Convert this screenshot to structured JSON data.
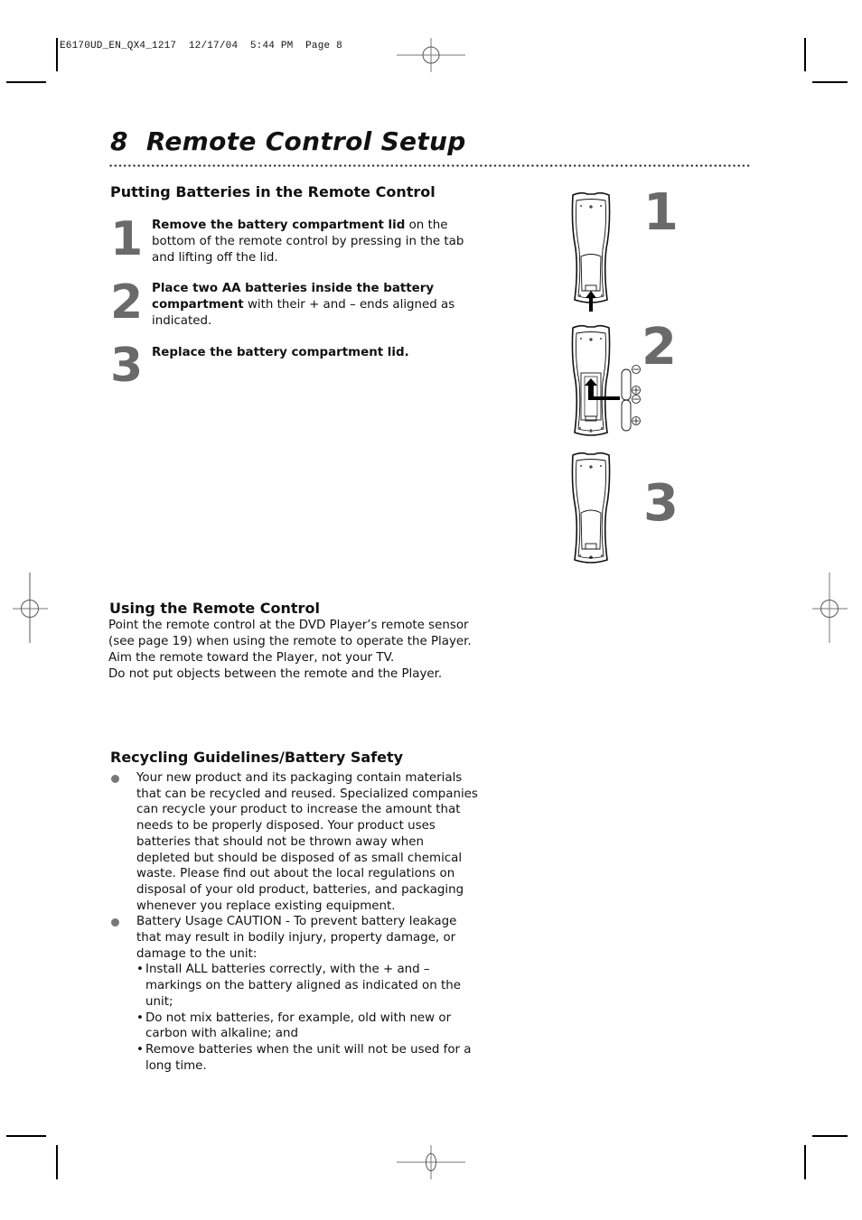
{
  "print_slug": {
    "file": "E6170UD_EN_QX4_1217",
    "date": "12/17/04",
    "time": "5:44 PM",
    "page_label": "Page 8"
  },
  "page": {
    "number": "8",
    "title": "Remote Control Setup"
  },
  "batteries_section": {
    "heading": "Putting Batteries in the Remote Control",
    "steps": [
      {
        "number": "1",
        "bold": "Remove the battery compartment lid",
        "text": " on the bottom of the remote control by pressing in the tab and lifting off the lid."
      },
      {
        "number": "2",
        "bold": "Place two AA batteries inside the battery compartment",
        "text": " with their + and – ends aligned as indicated."
      },
      {
        "number": "3",
        "bold": "Replace the battery compartment lid.",
        "text": ""
      }
    ]
  },
  "illustrations": [
    {
      "number": "1",
      "icon": "remote-lid-removal-illustration"
    },
    {
      "number": "2",
      "icon": "remote-battery-insert-illustration",
      "battery_marks": [
        "⊖",
        "⊕",
        "⊖",
        "⊕"
      ]
    },
    {
      "number": "3",
      "icon": "remote-lid-replaced-illustration"
    }
  ],
  "using_section": {
    "heading": "Using the Remote Control",
    "lines": [
      "Point the remote control at the DVD Player’s remote sensor",
      "(see page 19) when using the remote to operate the Player.",
      "Aim the remote toward the Player, not your TV.",
      "Do not put objects between the remote and the Player."
    ]
  },
  "recycling_section": {
    "heading": "Recycling Guidelines/Battery Safety",
    "bullets": [
      {
        "text": "Your new product and its packaging contain materials that can be recycled and reused. Specialized companies can recycle your product to increase the amount that needs to be properly disposed. Your product uses batteries that should not be thrown away when depleted but should be disposed of as small chemical waste. Please find out about the local regulations on disposal of your old product, batteries, and packaging whenever you replace existing equipment."
      },
      {
        "text": "Battery Usage CAUTION - To prevent battery leakage that may result in bodily injury, property damage, or damage to the unit:",
        "sub_items": [
          "Install ALL batteries correctly, with the + and – markings on the battery aligned as indicated on the unit;",
          "Do not mix batteries, for example, old with new or carbon with alkaline; and",
          "Remove batteries when the unit will not be used for a long time."
        ]
      }
    ]
  }
}
